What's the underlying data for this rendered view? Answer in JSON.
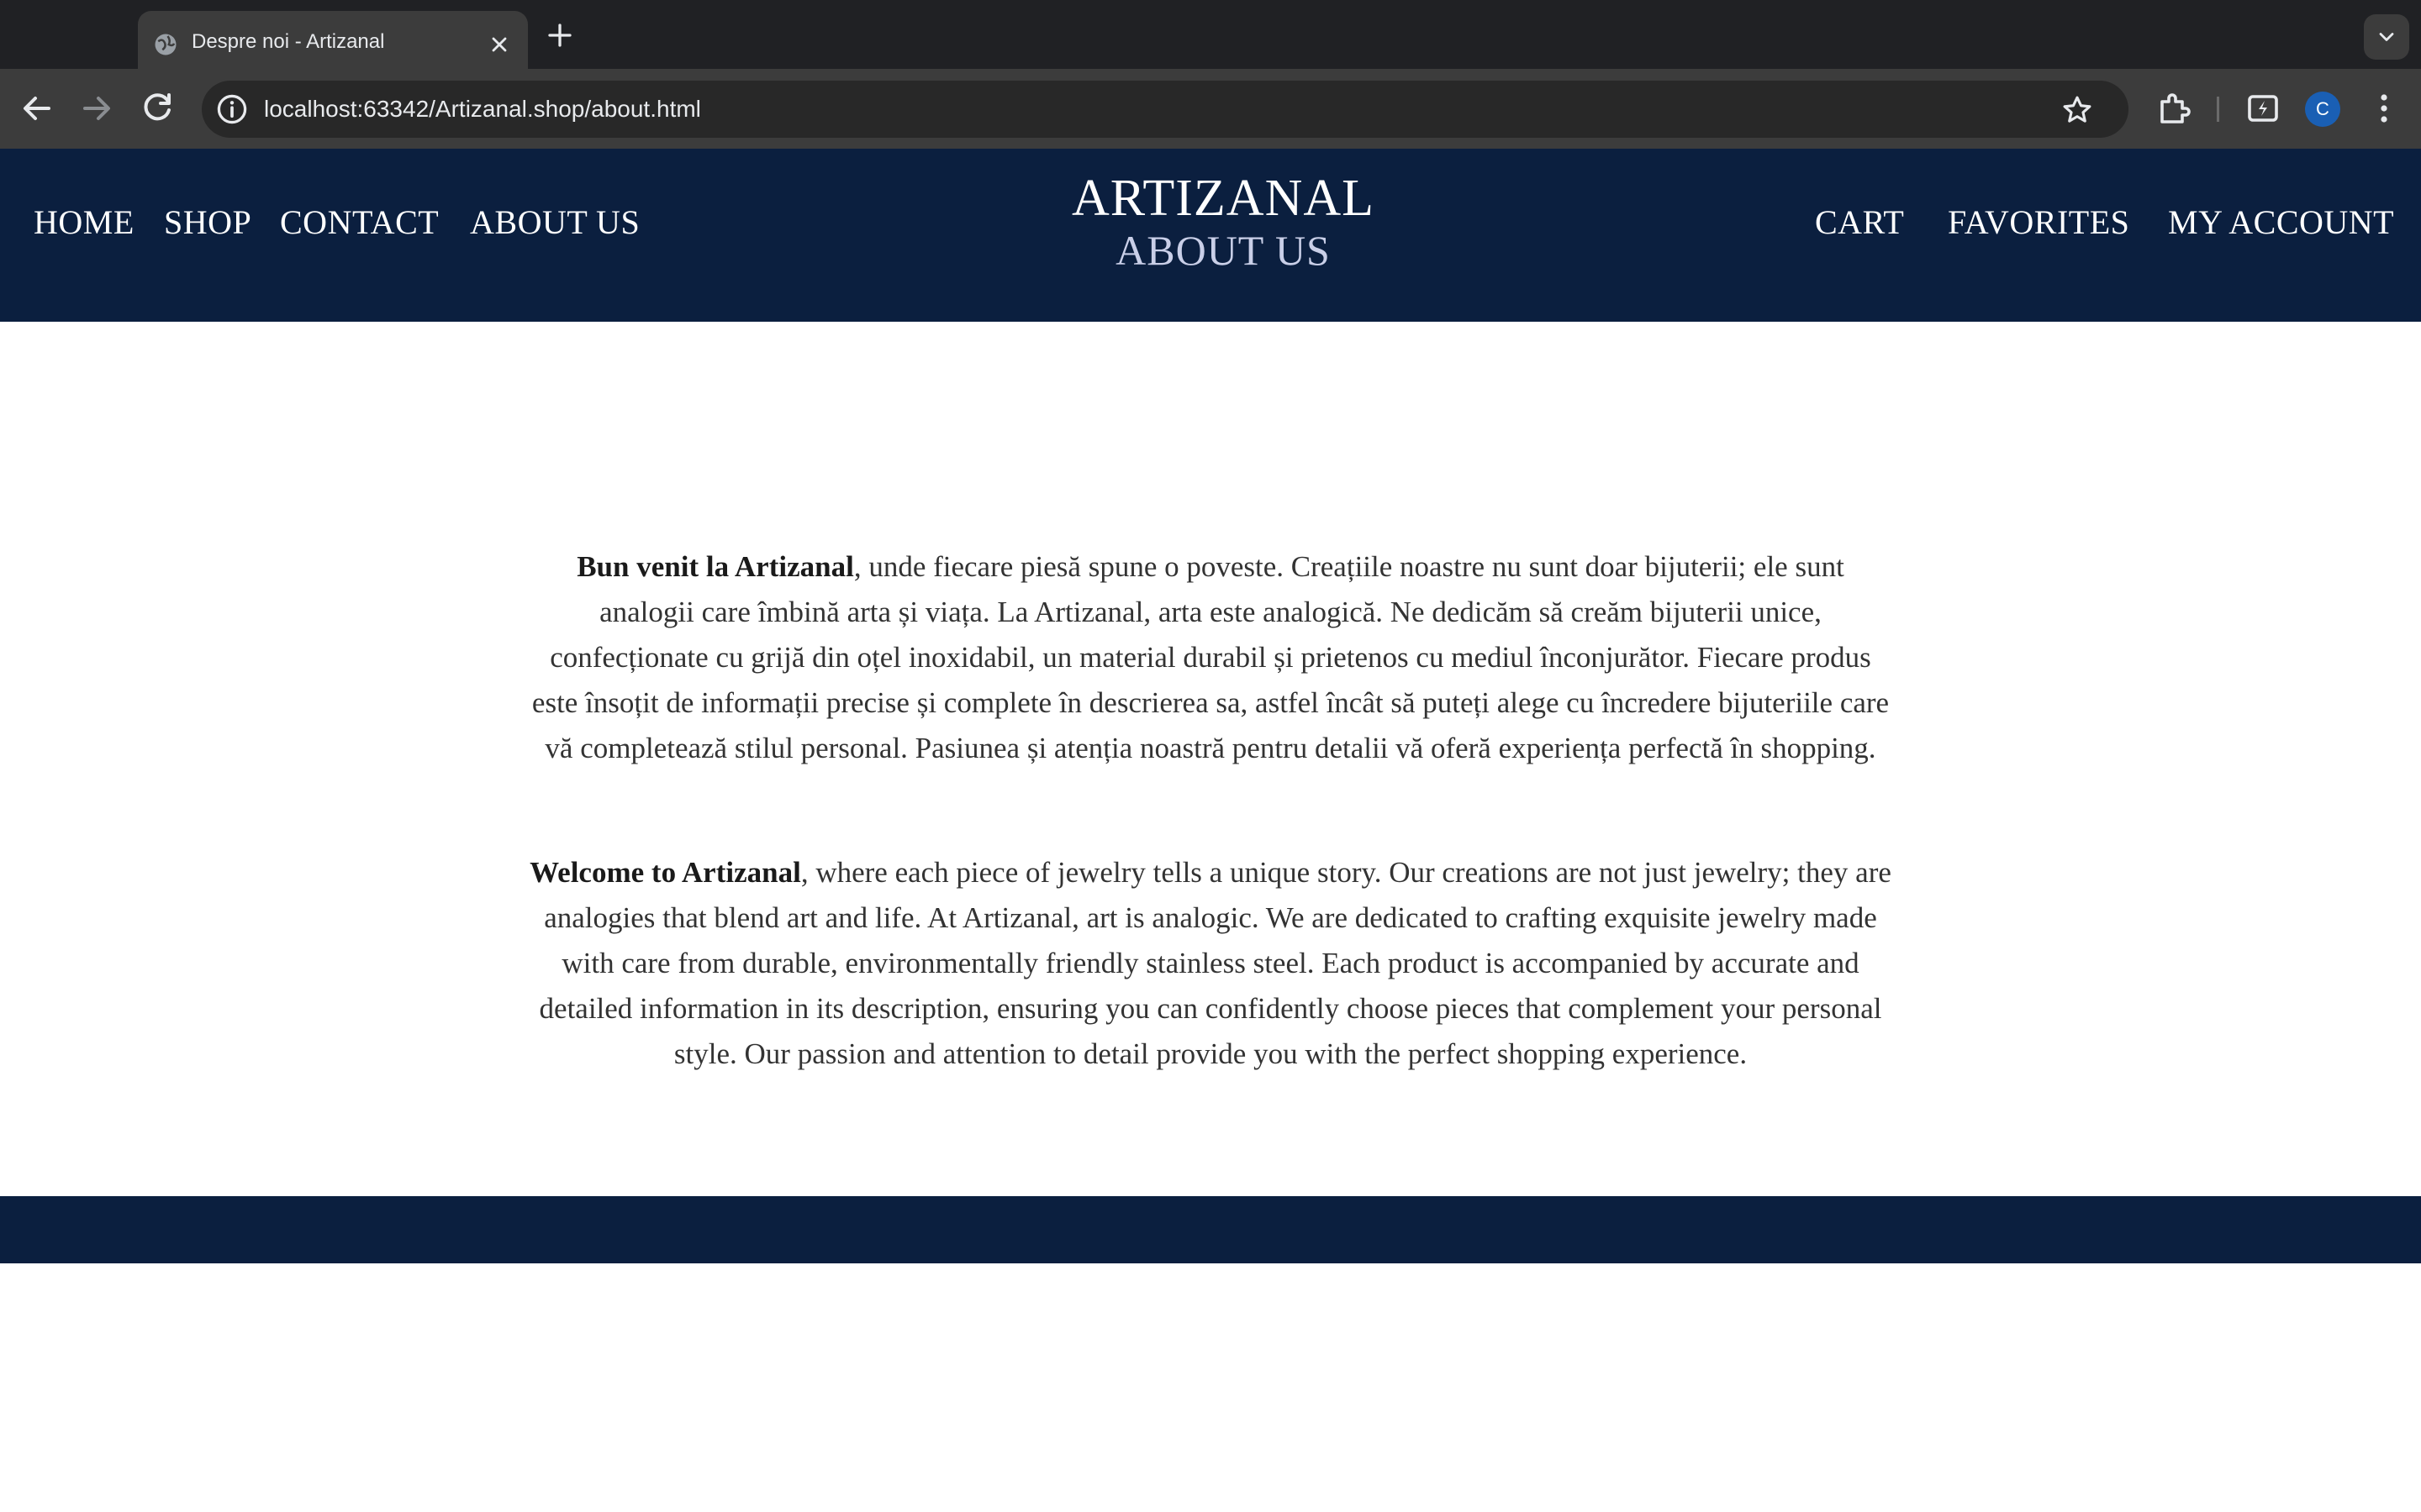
{
  "browser": {
    "tab": {
      "title": "Despre noi - Artizanal"
    },
    "address_bar": {
      "url": "localhost:63342/Artizanal.shop/about.html"
    },
    "profile_initial": "C",
    "icons": [
      "globe-icon",
      "close-icon",
      "plus-icon",
      "chevron-down-icon",
      "back-arrow-icon",
      "forward-arrow-icon",
      "reload-icon",
      "info-icon",
      "star-icon",
      "extensions-icon",
      "performance-icon",
      "kebab-menu-icon"
    ]
  },
  "header": {
    "brand": "ARTIZANAL",
    "page_title": "ABOUT US",
    "nav_left": [
      "HOME",
      "SHOP",
      "CONTACT",
      "ABOUT US"
    ],
    "nav_right": [
      "CART",
      "FAVORITES",
      "MY ACCOUNT"
    ],
    "background_color": "#0b1f3f"
  },
  "content": {
    "ro": {
      "lead": "Bun venit la Artizanal",
      "body": ", unde fiecare piesă spune o poveste. Creațiile noastre nu sunt doar bijuterii; ele sunt analogii care îmbină arta și viața. La Artizanal, arta este analogică. Ne dedicăm să creăm bijuterii unice, confecționate cu grijă din oțel inoxidabil, un material durabil și prietenos cu mediul înconjurător. Fiecare produs este însoțit de informații precise și complete în descrierea sa, astfel încât să puteți alege cu încredere bijuteriile care vă completează stilul personal. Pasiunea și atenția noastră pentru detalii vă oferă experiența perfectă în shopping."
    },
    "en": {
      "lead": "Welcome to Artizanal",
      "body": ", where each piece of jewelry tells a unique story. Our creations are not just jewelry; they are analogies that blend art and life. At Artizanal, art is analogic. We are dedicated to crafting exquisite jewelry made with care from durable, environmentally friendly stainless steel. Each product is accompanied by accurate and detailed information in its description, ensuring you can confidently choose pieces that complement your personal style. Our passion and attention to detail provide you with the perfect shopping experience."
    }
  },
  "footer": {
    "background_color": "#0b1f3f"
  }
}
